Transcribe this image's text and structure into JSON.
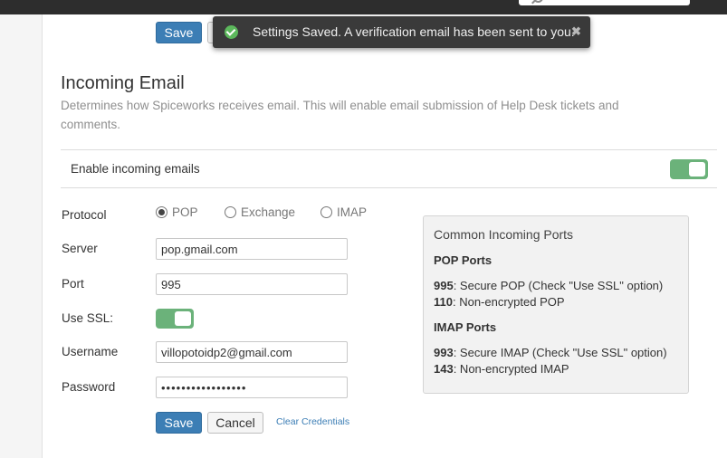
{
  "top_save_label": "Save",
  "toast": {
    "message": "Settings Saved. A verification email has been sent to you.",
    "close_glyph": "✖"
  },
  "section": {
    "title": "Incoming Email",
    "description": "Determines how Spiceworks receives email. This will enable email submission of Help Desk tickets and comments."
  },
  "enable": {
    "label": "Enable incoming emails",
    "on": true
  },
  "form": {
    "protocol_label": "Protocol",
    "protocol_options": [
      "POP",
      "Exchange",
      "IMAP"
    ],
    "protocol_selected": "POP",
    "server_label": "Server",
    "server_value": "pop.gmail.com",
    "port_label": "Port",
    "port_value": "995",
    "ssl_label": "Use SSL:",
    "ssl_on": true,
    "username_label": "Username",
    "username_value": "villopotoidp2@gmail.com",
    "password_label": "Password",
    "password_value": "abcdefghijklmnopq"
  },
  "actions": {
    "save": "Save",
    "cancel": "Cancel",
    "clear": "Clear Credentials"
  },
  "ports": {
    "title": "Common Incoming Ports",
    "pop_title": "POP Ports",
    "pop": [
      {
        "num": "995",
        "desc": ": Secure POP (Check \"Use SSL\" option)"
      },
      {
        "num": "110",
        "desc": ": Non-encrypted POP"
      }
    ],
    "imap_title": "IMAP Ports",
    "imap": [
      {
        "num": "993",
        "desc": ": Secure IMAP (Check \"Use SSL\" option)"
      },
      {
        "num": "143",
        "desc": ": Non-encrypted IMAP"
      }
    ]
  },
  "icons": {
    "toast": "check-circle-icon",
    "close": "close-icon",
    "search": "search-icon"
  },
  "colors": {
    "primary": "#3c7eb5",
    "toggle_on": "#6bb27a",
    "toast_bg": "#3a3a3a",
    "success": "#5cb85c"
  }
}
